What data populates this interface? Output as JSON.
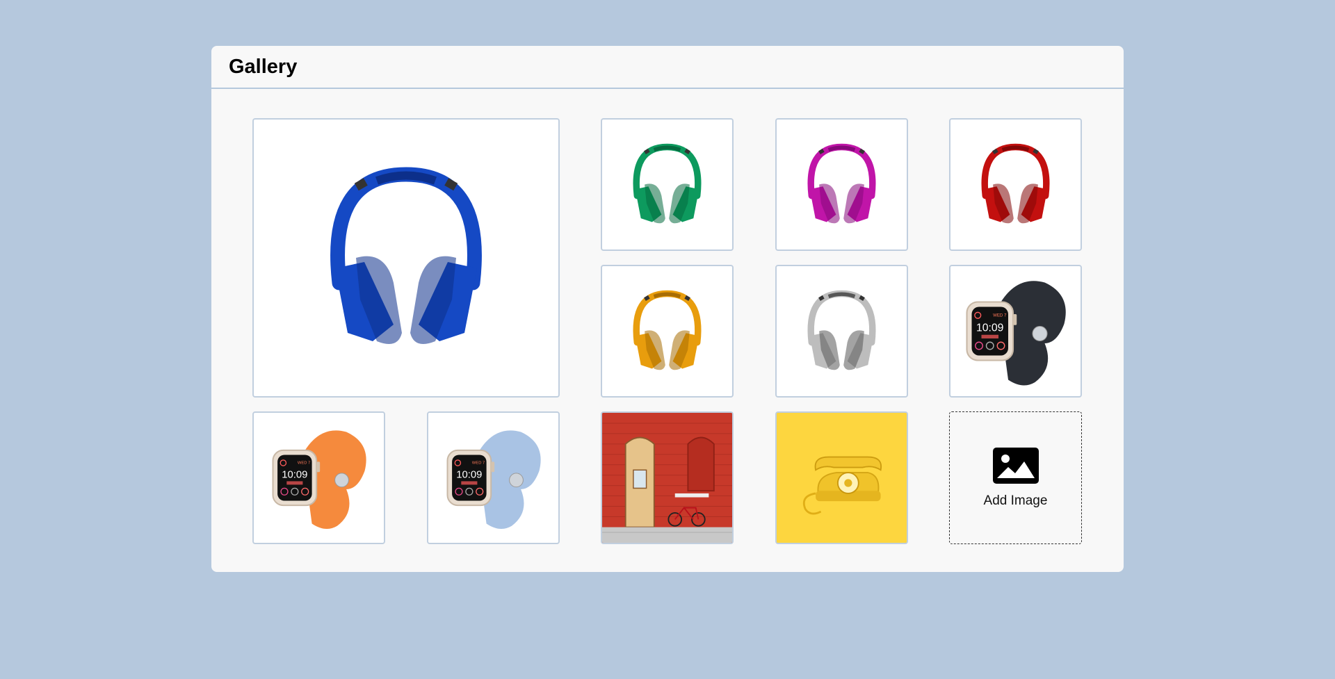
{
  "header": {
    "title": "Gallery"
  },
  "gallery": {
    "items": [
      {
        "kind": "headphones",
        "color": "#1549c4",
        "dark": "#0c2f8a",
        "label": "blue-headphones"
      },
      {
        "kind": "headphones",
        "color": "#0d9a5e",
        "dark": "#066b40",
        "label": "green-headphones"
      },
      {
        "kind": "headphones",
        "color": "#c015a8",
        "dark": "#85097a",
        "label": "magenta-headphones"
      },
      {
        "kind": "headphones",
        "color": "#c3100f",
        "dark": "#820707",
        "label": "red-headphones"
      },
      {
        "kind": "headphones",
        "color": "#e89d0d",
        "dark": "#a86d04",
        "label": "orange-headphones"
      },
      {
        "kind": "headphones",
        "color": "#bdbdbd",
        "dark": "#575757",
        "label": "silver-headphones"
      },
      {
        "kind": "watch",
        "band": "#2b2f36",
        "label": "black-band-watch"
      },
      {
        "kind": "watch",
        "band": "#f58a3d",
        "label": "orange-band-watch"
      },
      {
        "kind": "watch",
        "band": "#a9c3e4",
        "label": "blue-band-watch"
      },
      {
        "kind": "door",
        "label": "red-brick-door-photo"
      },
      {
        "kind": "phone",
        "label": "yellow-telephone-photo"
      }
    ],
    "add_tile": {
      "label": "Add Image",
      "icon": "image-icon"
    }
  },
  "watch_face": {
    "time": "10:09",
    "date": "WED 7"
  }
}
